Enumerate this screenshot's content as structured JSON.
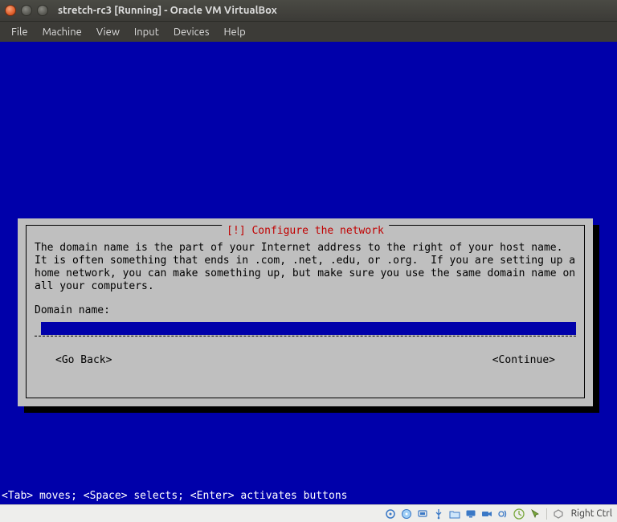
{
  "window": {
    "title": "stretch-rc3 [Running] - Oracle VM VirtualBox"
  },
  "menubar": {
    "items": [
      "File",
      "Machine",
      "View",
      "Input",
      "Devices",
      "Help"
    ]
  },
  "installer": {
    "dialog_title": "[!] Configure the network",
    "description": "The domain name is the part of your Internet address to the right of your host name.  It is often something that ends in .com, .net, .edu, or .org.  If you are setting up a home network, you can make something up, but make sure you use the same domain name on all your computers.",
    "prompt_label": "Domain name:",
    "input_value": "",
    "go_back_label": "<Go Back>",
    "continue_label": "<Continue>",
    "hints": "<Tab> moves; <Space> selects; <Enter> activates buttons"
  },
  "statusbar": {
    "icons": [
      "hd-icon",
      "cd-icon",
      "net-icon",
      "usb-icon",
      "shared-folder-icon",
      "display-icon",
      "video-capture-icon",
      "audio-icon",
      "keyboard-icon",
      "mouse-icon"
    ],
    "host_key": "Right Ctrl"
  },
  "colors": {
    "vm_bg": "#0000aa",
    "dialog_bg": "#bfbfbf",
    "dialog_title": "#c00000",
    "titlebar": "#3c3b37"
  }
}
